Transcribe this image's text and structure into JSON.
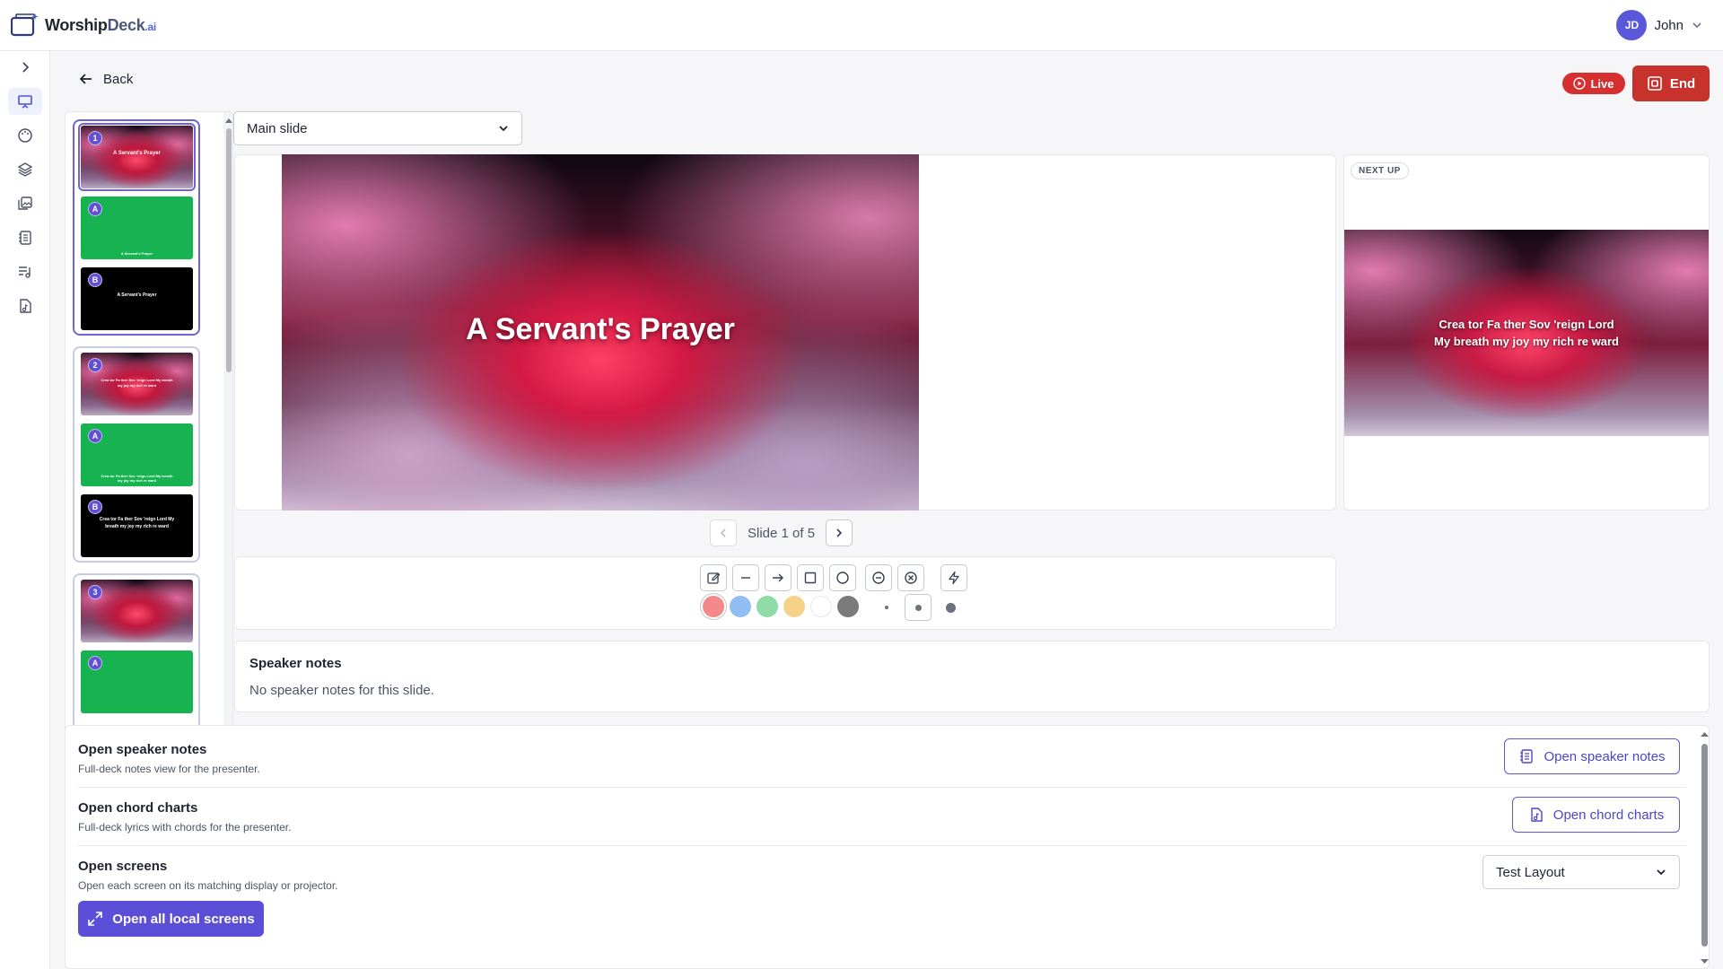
{
  "app": {
    "logo_name": "Worship",
    "logo_name_accent": "Deck",
    "logo_suffix": ".ai"
  },
  "user": {
    "initials": "JD",
    "name": "John"
  },
  "header": {
    "back_label": "Back",
    "live_label": "Live",
    "end_label": "End"
  },
  "slide_select": {
    "selected": "Main slide"
  },
  "current_slide": {
    "title": "A Servant's Prayer"
  },
  "next_up": {
    "label": "NEXT UP",
    "line1": "Crea tor Fa ther Sov 'reign Lord",
    "line2": "My breath my joy my rich re ward"
  },
  "pager": {
    "text": "Slide 1 of 5"
  },
  "thumbnails": [
    {
      "group": "1",
      "slides": [
        {
          "badge": "1",
          "style": "cloud",
          "text": "A Servant's Prayer"
        },
        {
          "badge": "A",
          "style": "green",
          "text": "A Servant's Prayer"
        },
        {
          "badge": "B",
          "style": "black",
          "text": "A Servant's Prayer"
        }
      ]
    },
    {
      "group": "2",
      "slides": [
        {
          "badge": "2",
          "style": "cloud",
          "text": "Crea tor Fa ther Sov 'reign Lord My breath my joy my rich re ward"
        },
        {
          "badge": "A",
          "style": "green",
          "text": "Crea tor Fa ther Sov 'reign Lord My breath my joy my rich re ward"
        },
        {
          "badge": "B",
          "style": "black",
          "text": "Crea tor Fa ther Sov 'reign Lord My breath my joy my rich re ward"
        }
      ]
    },
    {
      "group": "3",
      "slides": [
        {
          "badge": "3",
          "style": "cloud",
          "text": ""
        },
        {
          "badge": "A",
          "style": "green",
          "text": ""
        }
      ]
    }
  ],
  "tools": [
    {
      "name": "pen-tool",
      "icon": "pen-square-icon"
    },
    {
      "name": "line-tool",
      "icon": "minus-icon"
    },
    {
      "name": "arrow-tool",
      "icon": "arrow-right-icon"
    },
    {
      "name": "rectangle-tool",
      "icon": "square-icon"
    },
    {
      "name": "circle-tool",
      "icon": "circle-icon"
    },
    {
      "name": "erase-tool",
      "icon": "circle-minus-icon"
    },
    {
      "name": "clear-tool",
      "icon": "circle-x-icon"
    },
    {
      "name": "laser-tool",
      "icon": "zap-icon"
    }
  ],
  "colors": {
    "swatches": [
      "#f3898a",
      "#93bdf5",
      "#8fdca6",
      "#f4d388",
      "#ffffff",
      "#7a7a7a"
    ],
    "accent": "#5b4fd8",
    "live": "#d62f2f",
    "end": "#c7322c"
  },
  "speaker_notes": {
    "title": "Speaker notes",
    "body": "No speaker notes for this slide."
  },
  "presenter_tools": {
    "speaker_notes": {
      "title": "Open speaker notes",
      "desc": "Full-deck notes view for the presenter.",
      "button": "Open speaker notes"
    },
    "chord_charts": {
      "title": "Open chord charts",
      "desc": "Full-deck lyrics with chords for the presenter.",
      "button": "Open chord charts"
    },
    "screens": {
      "title": "Open screens",
      "desc": "Open each screen on its matching display or projector.",
      "layout_selected": "Test Layout",
      "button": "Open all local screens"
    }
  }
}
